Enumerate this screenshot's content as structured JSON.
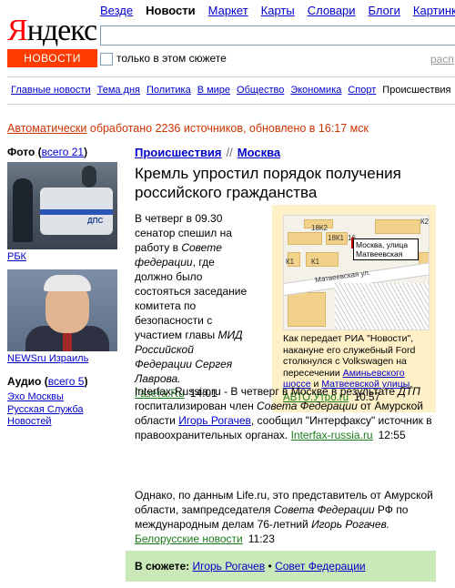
{
  "logo": {
    "first_letter": "Я",
    "rest": "ндекс"
  },
  "news_button": "НОВОСТИ",
  "topnav": [
    "Везде",
    "Новости",
    "Маркет",
    "Карты",
    "Словари",
    "Блоги",
    "Картинки"
  ],
  "topnav_current": "Новости",
  "search": {
    "value": ""
  },
  "only_story_label": "только в этом сюжете",
  "right_link_partial": "расп",
  "categories": [
    "Главные новости",
    "Тема дня",
    "Политика",
    "В мире",
    "Общество",
    "Экономика",
    "Спорт",
    "Происшествия"
  ],
  "category_current": "Происшествия",
  "auto": {
    "prefix": "Автоматически",
    "text": " обработано 2236 источников, обновлено в 16:17 мск"
  },
  "photos": {
    "title": "Фото",
    "all_link": "всего 21",
    "photo1_caption": "РБК",
    "photo1_plate": "ДПС",
    "photo2_caption": "NEWSru Израиль"
  },
  "audio": {
    "title": "Аудио",
    "all_link": "всего 5",
    "items": [
      "Эхо Москвы",
      "Русская Служба Новостей"
    ]
  },
  "breadcrumb": {
    "section": "Происшествия",
    "sep": "//",
    "region": "Москва"
  },
  "headline": "Кремль упростил порядок получения российского гражданства",
  "story1": {
    "t1": "В четверг в 09.30 сенатор спешил на работу в ",
    "i1": "Совете федерации",
    "t2": ", где должно было состояться заседание комитета по безопасности с участием главы ",
    "i2": "МИД Российской Федерации Сергея Лаврова.",
    "source": "Газета.Ru",
    "time": "14:01"
  },
  "map": {
    "labels": [
      "18К2",
      "18К1",
      "16",
      "К2",
      "К1",
      "К1"
    ],
    "street": "Матвеевская ул.",
    "tooltip": "Москва, улица Матвеевская",
    "caption_t1": "Как передает РИА \"Новости\", накануне его служебный Ford столкнулся с Volkswagen на пересечении ",
    "caption_l1": "Аминьевского шоссе",
    "caption_t2": " и ",
    "caption_l2": "Матвеевской улицы",
    "caption_t3": ".",
    "source": "АВТО.Утро.ru",
    "time": "10:57"
  },
  "story2": {
    "t1": "Interfax-Russia.ru - В четверг в Москве в результате ",
    "i1": "ДТП",
    "t2": " госпитализирован член ",
    "i2": "Совета Федерации",
    "t3": " от Амурской области ",
    "l1": "Игорь Рогачев",
    "t4": ", сообщил \"Интерфаксу\" источник в правоохранительных органах.",
    "source": "Interfax-russia.ru",
    "time": "12:55"
  },
  "story3": {
    "t1": "Однако, по данным Life.ru, это представитель от Амурской области, зампредседателя ",
    "i1": "Совета Федерации",
    "t2": " РФ по международным делам 76-летний ",
    "i2": "Игорь Рогачев.",
    "source": "Белорусские новости",
    "time": "11:23"
  },
  "in_story": {
    "label": "В сюжете:",
    "items": [
      "Игорь Рогачев",
      "Совет Федерации"
    ],
    "sep": "•"
  },
  "colors": {
    "accent": "#ff3b00",
    "logo_red": "#ff0000",
    "link": "#0000cc",
    "source": "#1a7a1a",
    "info_red": "#cc3300",
    "map_box": "#fef0c7",
    "sujet_bg": "#c9e9b8"
  }
}
